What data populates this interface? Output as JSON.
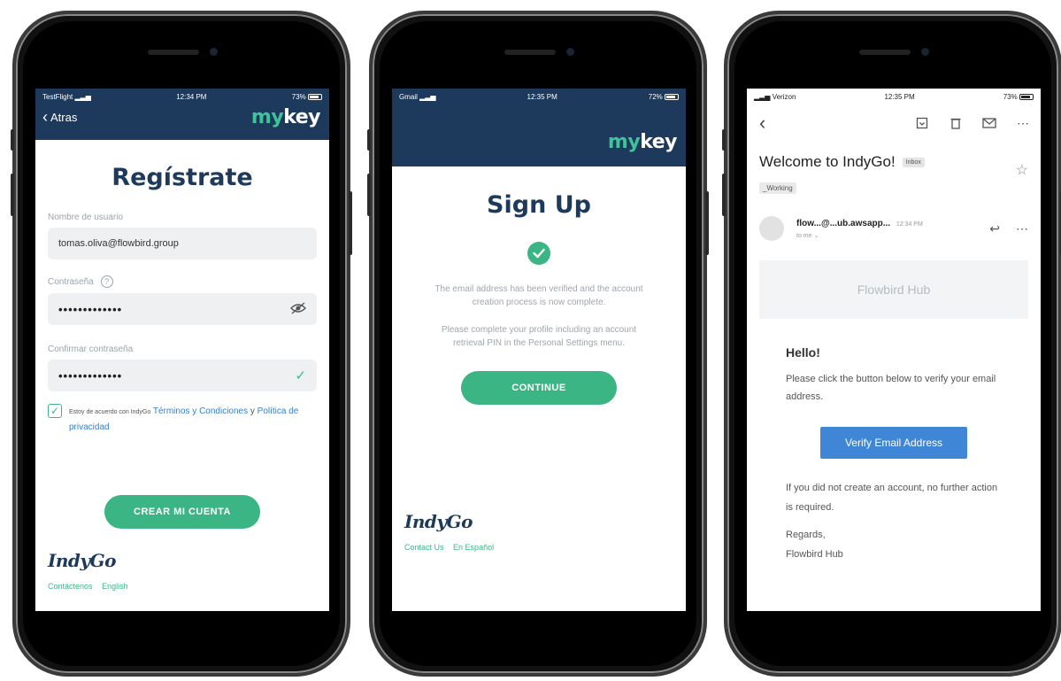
{
  "phone1": {
    "status": {
      "carrier": "TestFlight",
      "time": "12:34 PM",
      "battery": "73%"
    },
    "nav": {
      "back_label": "Atras"
    },
    "logo": {
      "part1": "my",
      "part2": "key"
    },
    "title": "Regístrate",
    "username": {
      "label": "Nombre de usuario",
      "value": "tomas.oliva@flowbird.group"
    },
    "password": {
      "label": "Contraseña",
      "value": "•••••••••••••"
    },
    "confirm": {
      "label": "Confirmar contraseña",
      "value": "•••••••••••••"
    },
    "terms": {
      "prefix": "Estoy de acuerdo con IndyGo",
      "terms_link": "Términos y Condiciones",
      "joiner": "y",
      "privacy_link": "Política de privacidad"
    },
    "create_button": "CREAR MI CUENTA",
    "brand": "IndyGo",
    "footer": {
      "link1": "Contáctenos",
      "link2": "English"
    }
  },
  "phone2": {
    "status": {
      "carrier": "Gmail",
      "time": "12:35 PM",
      "battery": "72%"
    },
    "logo": {
      "part1": "my",
      "part2": "key"
    },
    "title": "Sign Up",
    "message1": "The email address has been verified and the account creation process is now complete.",
    "message2": "Please complete your profile including an account retrieval PIN in the Personal Settings menu.",
    "continue_button": "CONTINUE",
    "brand": "IndyGo",
    "footer": {
      "link1": "Contact Us",
      "link2": "En Español"
    }
  },
  "phone3": {
    "status": {
      "carrier": "Verizon",
      "time": "12:35 PM",
      "battery": "73%"
    },
    "subject": "Welcome to IndyGo!",
    "inbox_tag": "Inbox",
    "label_tag": "_Working",
    "sender": "flow...@...ub.awsapp...",
    "sent_time": "12:34 PM",
    "to_line": "to me",
    "hub_banner": "Flowbird Hub",
    "greeting": "Hello!",
    "body1": "Please click the button below to verify your email address.",
    "verify_button": "Verify Email Address",
    "body2": "If you did not create an account, no further action is required.",
    "regards": "Regards,",
    "signature": "Flowbird Hub"
  },
  "colors": {
    "navy": "#1d3a5c",
    "green": "#3cb585",
    "blue": "#3f86d6"
  }
}
